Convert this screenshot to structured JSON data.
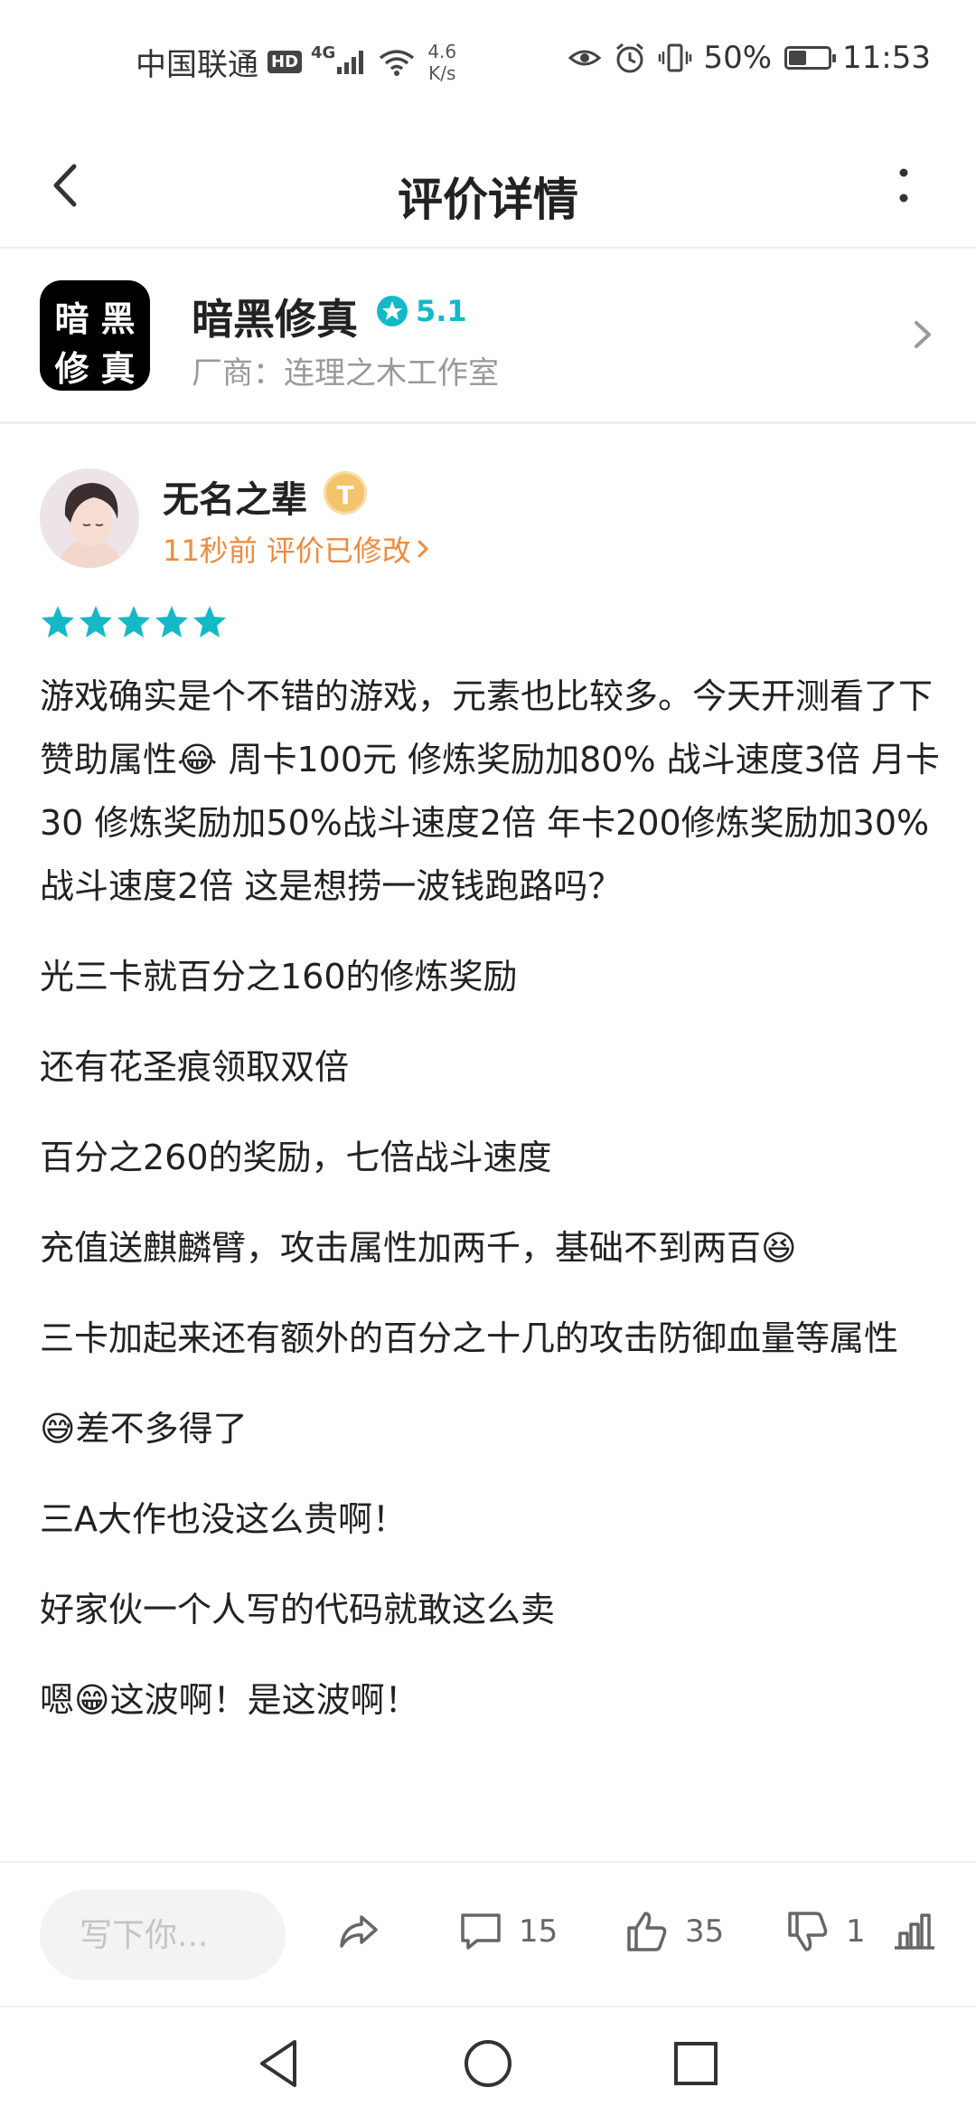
{
  "status_bar": {
    "carrier": "中国联通",
    "hd": "HD",
    "network": "4G",
    "speed_value": "4.6",
    "speed_unit": "K/s",
    "battery": "50%",
    "battery_level": 0.5,
    "time": "11:53"
  },
  "header": {
    "title": "评价详情",
    "back_icon": "chevron-left-icon",
    "more_icon": "more-vertical-icon"
  },
  "app": {
    "icon_chars": [
      "暗",
      "黑",
      "修",
      "真"
    ],
    "name": "暗黑修真",
    "rating": "5.1",
    "vendor": "厂商：连理之木工作室"
  },
  "review": {
    "reviewer_name": "无名之辈",
    "level_badge": "T",
    "time": "11秒前",
    "edited": "评价已修改",
    "star_count": 5,
    "star_color": "#14b9c8",
    "paragraphs": [
      "游戏确实是个不错的游戏，元素也比较多。今天开测看了下赞助属性😂 周卡100元 修炼奖励加80% 战斗速度3倍 月卡30 修炼奖励加50%战斗速度2倍 年卡200修炼奖励加30%战斗速度2倍 这是想捞一波钱跑路吗？",
      "光三卡就百分之160的修炼奖励",
      "还有花圣痕领取双倍",
      "百分之260的奖励，七倍战斗速度",
      "充值送麒麟臂，攻击属性加两千，基础不到两百😆",
      "三卡加起来还有额外的百分之十几的攻击防御血量等属性",
      "😅差不多得了",
      "三A大作也没这么贵啊！",
      "好家伙一个人写的代码就敢这么卖",
      "嗯😁这波啊！是这波啊！"
    ]
  },
  "actions": {
    "reply_placeholder": "写下你...",
    "comments": "15",
    "likes": "35",
    "dislikes": "1"
  },
  "colors": {
    "accent": "#14b9c8",
    "orange": "#f08a3c"
  }
}
